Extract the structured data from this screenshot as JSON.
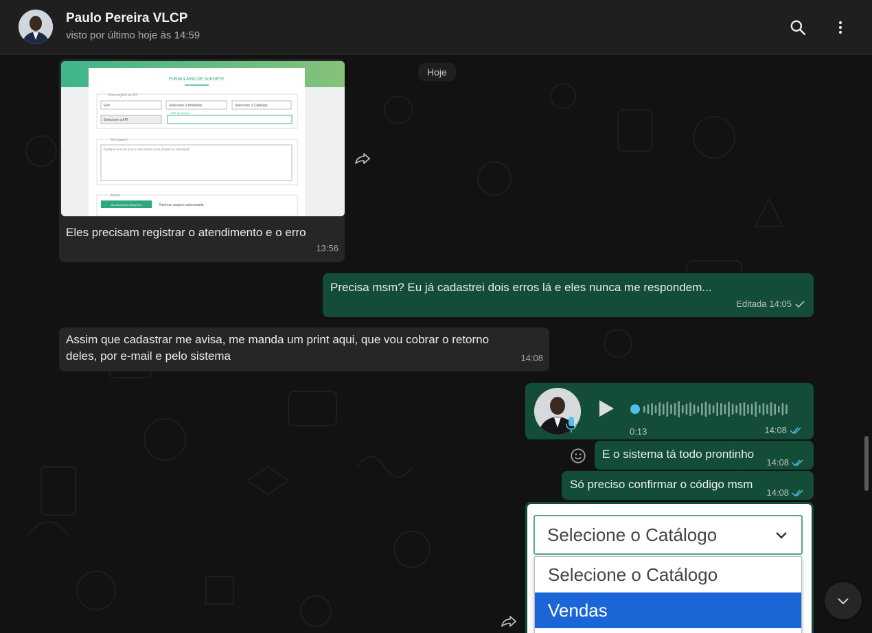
{
  "header": {
    "contact_name": "Paulo Pereira VLCP",
    "status": "visto por último hoje às 14:59",
    "icons": [
      "search-icon",
      "kebab-menu-icon"
    ]
  },
  "chat": {
    "date_pill": "Hoje",
    "messages": [
      {
        "direction": "incoming",
        "type": "image",
        "caption": "Eles precisam registrar o atendimento e o erro",
        "time": "13:56",
        "image_content": {
          "form_title": "FORMULÁRIO DE SUPORTE",
          "section_api": "Informações da API",
          "field_erro": "Erro",
          "field_ambiente": "Selecione o Ambiente",
          "field_catalogo": "Selecione o Catálogo",
          "field_api": "Selecione a API",
          "field_url_label": "URL do serviço",
          "section_mensagem": "Mensagem",
          "mensagem_placeholder": "Explique-nos um pouco mais sobre a sua dúvida ou solicitação",
          "section_anexo": "Anexo",
          "upload_button": "SELECIONAR ARQUIVO",
          "upload_status": "Nenhum arquivo selecionado"
        }
      },
      {
        "direction": "outgoing",
        "text": "Precisa msm? Eu já cadastrei dois erros lá e eles nunca me respondem...",
        "edited_label": "Editada",
        "time": "14:05",
        "status": "sent"
      },
      {
        "direction": "incoming",
        "text": "Assim que cadastrar me avisa, me manda um print aqui, que vou cobrar o retorno deles, por e-mail e pelo sistema",
        "time": "14:08"
      },
      {
        "direction": "outgoing",
        "type": "voice",
        "duration": "0:13",
        "time": "14:08",
        "status": "read",
        "progress": 0
      },
      {
        "direction": "outgoing",
        "text": "E o sistema tá todo prontinho",
        "time": "14:08",
        "status": "read"
      },
      {
        "direction": "outgoing",
        "text": "Só preciso confirmar o código msm",
        "time": "14:08",
        "status": "read"
      },
      {
        "direction": "outgoing",
        "type": "image",
        "image_content": {
          "select_value": "Selecione o Catálogo",
          "options": [
            "Selecione o Catálogo",
            "Vendas"
          ],
          "highlighted_option": "Vendas"
        }
      }
    ]
  },
  "colors": {
    "header_bg": "#1f1f1f",
    "incoming_bubble": "#262626",
    "outgoing_bubble": "#144d37",
    "read_tick": "#53bdeb",
    "highlight_option": "#1a66d6"
  }
}
